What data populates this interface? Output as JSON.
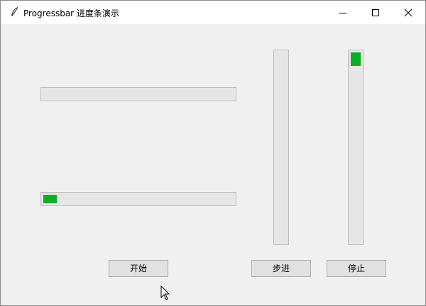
{
  "window": {
    "title": "Progressbar 进度条演示",
    "icon": "feather-icon",
    "controls": [
      "minimize-icon",
      "maximize-icon",
      "close-icon"
    ]
  },
  "progressbars": {
    "horizontal_top": {
      "orient": "horizontal",
      "value": 0
    },
    "horizontal_bottom": {
      "orient": "horizontal",
      "value": 0.07
    },
    "vertical_left": {
      "orient": "vertical",
      "value": 0
    },
    "vertical_right": {
      "orient": "vertical",
      "value": 0.07
    }
  },
  "buttons": {
    "start": "开始",
    "step": "步进",
    "stop": "停止"
  },
  "colors": {
    "chunk": "#06b025",
    "trough": "#e6e6e6",
    "background": "#f0f0f0"
  }
}
